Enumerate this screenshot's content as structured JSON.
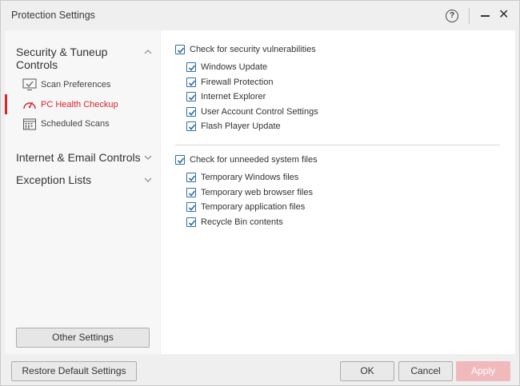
{
  "window": {
    "title": "Protection Settings",
    "help_icon": "help-icon",
    "help_glyph": "?",
    "minimize_icon": "minimize-icon",
    "close_icon": "close-icon",
    "close_glyph": "✕"
  },
  "sidebar": {
    "groups": [
      {
        "label": "Security & Tuneup Controls",
        "expanded": true,
        "items": [
          {
            "label": "Scan Preferences",
            "icon": "monitor-check-icon",
            "active": false
          },
          {
            "label": "PC Health Checkup",
            "icon": "speedometer-icon",
            "active": true
          },
          {
            "label": "Scheduled Scans",
            "icon": "calendar-icon",
            "active": false
          }
        ]
      },
      {
        "label": "Internet & Email Controls",
        "expanded": false
      },
      {
        "label": "Exception Lists",
        "expanded": false
      }
    ],
    "other_settings_label": "Other Settings"
  },
  "main": {
    "section1": {
      "label": "Check for security vulnerabilities",
      "checked": true,
      "items": [
        {
          "label": "Windows Update",
          "checked": true
        },
        {
          "label": "Firewall Protection",
          "checked": true
        },
        {
          "label": "Internet Explorer",
          "checked": true
        },
        {
          "label": "User Account Control Settings",
          "checked": true
        },
        {
          "label": "Flash Player Update",
          "checked": true
        }
      ]
    },
    "section2": {
      "label": "Check for unneeded system files",
      "checked": true,
      "items": [
        {
          "label": "Temporary Windows files",
          "checked": true
        },
        {
          "label": "Temporary web browser files",
          "checked": true
        },
        {
          "label": "Temporary application files",
          "checked": true
        },
        {
          "label": "Recycle Bin contents",
          "checked": true
        }
      ]
    }
  },
  "footer": {
    "restore_label": "Restore Default Settings",
    "ok_label": "OK",
    "cancel_label": "Cancel",
    "apply_label": "Apply"
  },
  "colors": {
    "accent_red": "#d4262f",
    "checkbox_blue": "#2e6da4",
    "apply_disabled": "#f0b9bc"
  }
}
